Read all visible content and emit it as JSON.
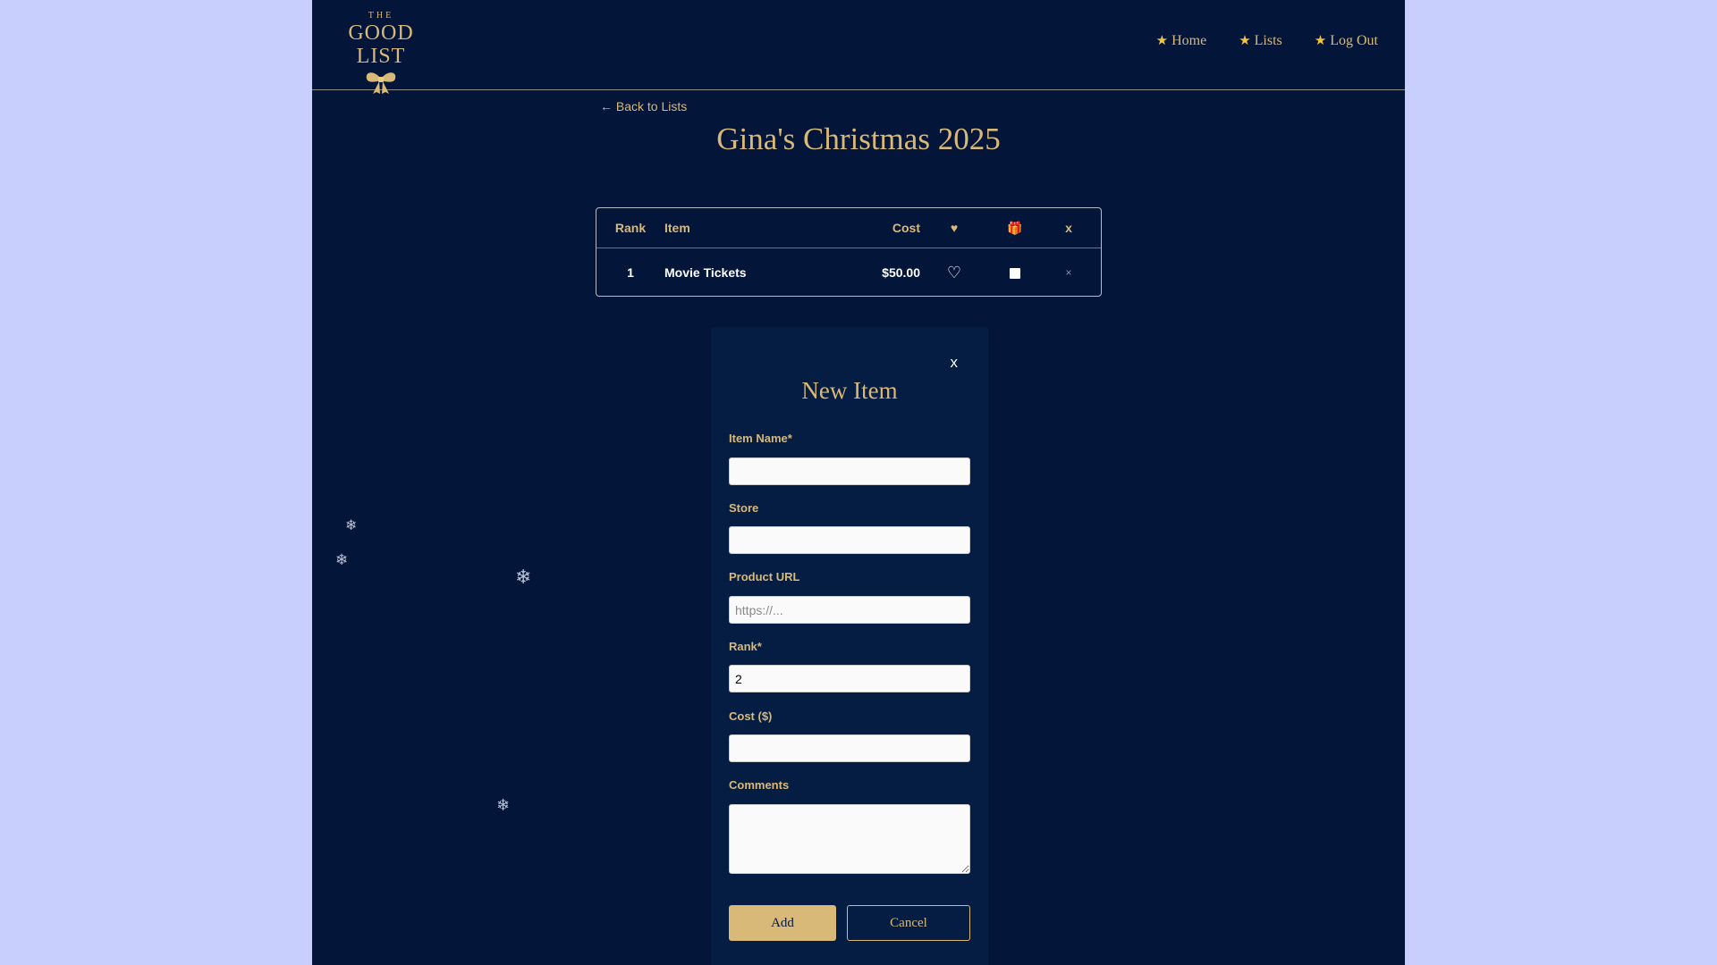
{
  "header": {
    "logo_the": "THE",
    "logo_main": "GOOD LIST",
    "nav": [
      {
        "label": "Home"
      },
      {
        "label": "Lists"
      },
      {
        "label": "Log Out"
      }
    ]
  },
  "back_link": "← Back to Lists",
  "list_title": "Gina's Christmas 2025",
  "table": {
    "headers": {
      "rank": "Rank",
      "item": "Item",
      "cost": "Cost",
      "heart": "♥",
      "gift": "🎁",
      "remove": "x"
    },
    "rows": [
      {
        "rank": "1",
        "item": "Movie Tickets",
        "cost": "$50.00",
        "heart": "♡",
        "remove": "×"
      }
    ]
  },
  "modal": {
    "close": "x",
    "title": "New Item",
    "fields": {
      "item_name": {
        "label": "Item Name*",
        "value": "",
        "placeholder": ""
      },
      "store": {
        "label": "Store",
        "value": "",
        "placeholder": ""
      },
      "product_url": {
        "label": "Product URL",
        "value": "",
        "placeholder": "https://..."
      },
      "rank": {
        "label": "Rank*",
        "value": "2",
        "placeholder": ""
      },
      "cost": {
        "label": "Cost ($)",
        "value": "",
        "placeholder": ""
      },
      "comments": {
        "label": "Comments",
        "value": "",
        "placeholder": ""
      }
    },
    "add_label": "Add",
    "cancel_label": "Cancel"
  },
  "icons": {
    "nav_star": "star-icon",
    "snowflake": "snowflake-icon",
    "bow": "bow-icon"
  },
  "colors": {
    "background": "#c9cffd",
    "page": "#03163a",
    "gold": "#d8b978"
  }
}
